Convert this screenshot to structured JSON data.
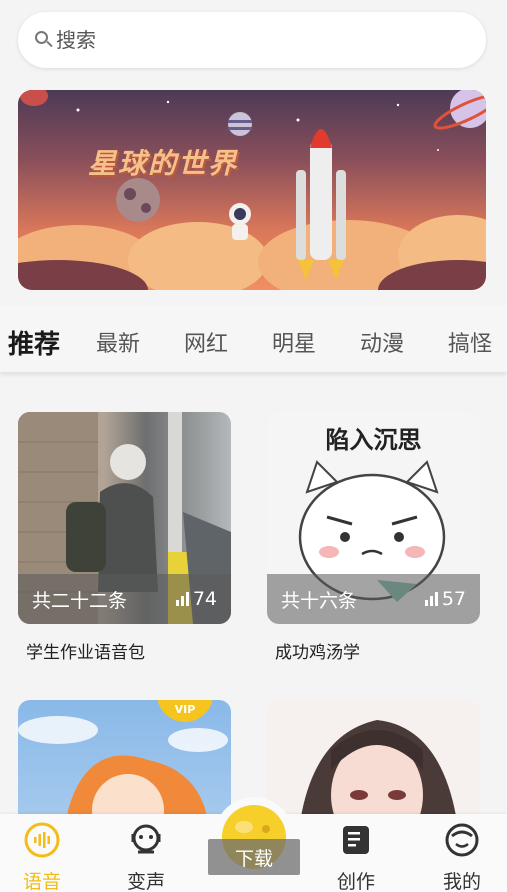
{
  "search": {
    "placeholder": "搜索"
  },
  "banner": {
    "title": "星球的世界"
  },
  "tabs": [
    {
      "label": "推荐",
      "active": true
    },
    {
      "label": "最新"
    },
    {
      "label": "网红"
    },
    {
      "label": "明星"
    },
    {
      "label": "动漫"
    },
    {
      "label": "搞怪"
    }
  ],
  "cards": [
    {
      "title": "学生作业语音包",
      "count_text": "共二十二条",
      "plays": "74"
    },
    {
      "title": "成功鸡汤学",
      "count_text": "共十六条",
      "plays": "57",
      "image_text": "陷入沉思"
    },
    {
      "badge": "VIP"
    },
    {}
  ],
  "nav": {
    "items": [
      {
        "label": "语音",
        "icon": "voice-icon",
        "active": true
      },
      {
        "label": "变声",
        "icon": "voice-changer-icon"
      },
      {
        "label": "下载",
        "icon": "download-icon"
      },
      {
        "label": "创作",
        "icon": "create-icon"
      },
      {
        "label": "我的",
        "icon": "profile-icon"
      }
    ],
    "accent": "#f2bd16"
  }
}
